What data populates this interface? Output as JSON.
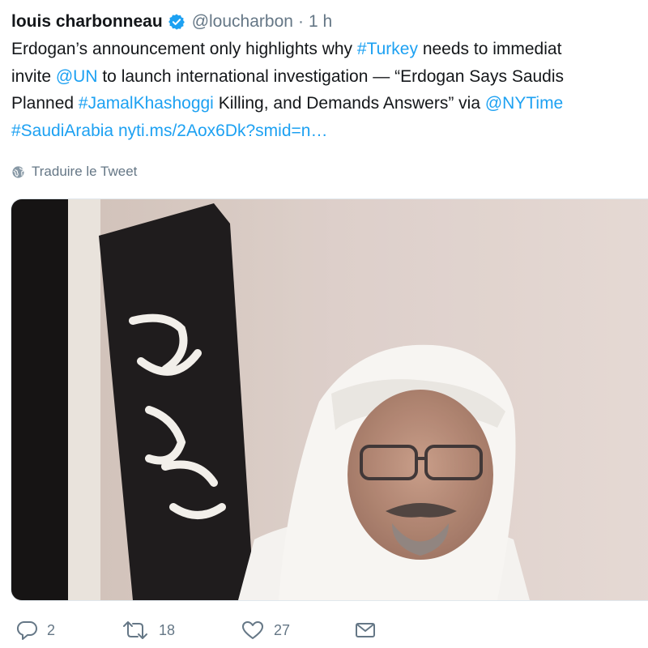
{
  "tweet": {
    "author_name": "louis charbonneau",
    "handle": "@loucharbon",
    "separator": "·",
    "time": "1 h",
    "text": {
      "l1_a": "Erdogan’s announcement only highlights why ",
      "l1_link": "#Turkey",
      "l1_b": " needs to immediat",
      "l2_a": "invite ",
      "l2_link": "@UN",
      "l2_b": " to launch international investigation — “Erdogan Says Saudis",
      "l3_a": "Planned ",
      "l3_link1": "#JamalKhashoggi",
      "l3_b": " Killing, and Demands Answers” via ",
      "l3_link2": "@NYTime",
      "l4_link1": "#SaudiArabia",
      "l4_space": " ",
      "l4_link2": "nyti.ms/2Aox6Dk?smid=n…"
    },
    "translate_label": "Traduire le Tweet",
    "actions": {
      "replies": "2",
      "retweets": "18",
      "likes": "27"
    }
  },
  "icons": {
    "verified": "verified-badge-icon",
    "globe": "globe-icon",
    "reply": "reply-icon",
    "retweet": "retweet-icon",
    "like": "heart-icon",
    "message": "direct-message-icon"
  },
  "colors": {
    "link": "#1da1f2",
    "secondary": "#657786",
    "text": "#14171a"
  }
}
